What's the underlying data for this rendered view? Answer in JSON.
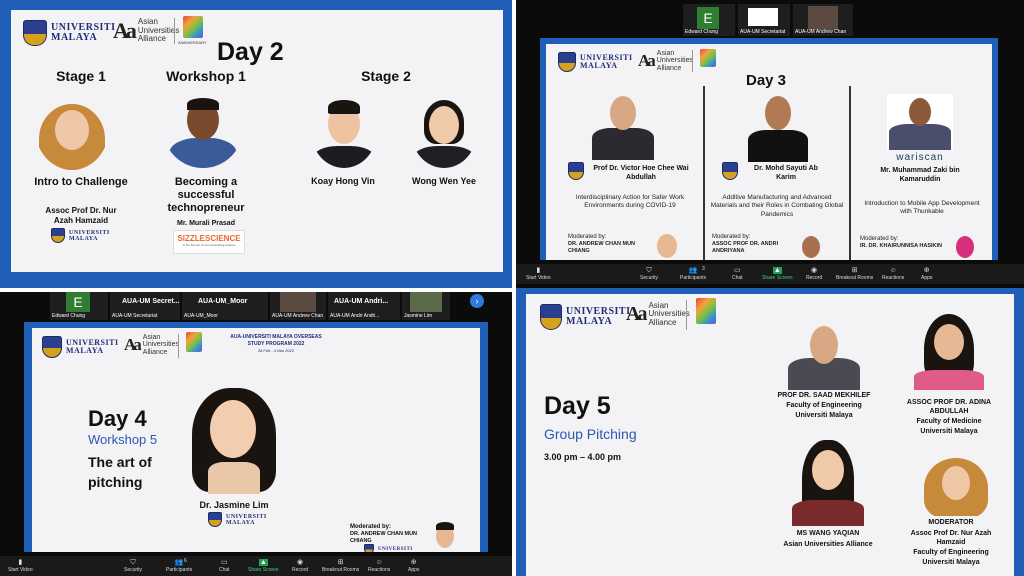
{
  "q1": {
    "um_text": "UNIVERSITI MALAYA",
    "aua_text": "Asian Universities Alliance",
    "anniv": "ANNIVERSARY",
    "day": "Day 2",
    "stage1": {
      "heading": "Stage 1",
      "title": "Intro to Challenge",
      "speaker": "Assoc Prof Dr. Nur Azah Hamzaid",
      "logo": "UNIVERSITI MALAYA"
    },
    "workshop1": {
      "heading": "Workshop 1",
      "title": "Becoming a successful technopreneur",
      "speaker": "Mr. Murali Prasad",
      "logo": "SIZZLESCIENCE",
      "logo_sub": "in the fine art of communicating science"
    },
    "stage2": {
      "heading": "Stage 2",
      "speaker_a": "Koay Hong Vin",
      "speaker_b": "Wong Wen Yee"
    }
  },
  "q2": {
    "tiles": [
      {
        "initial": "E",
        "name": "Edward Chung"
      },
      {
        "name": "AUA-UM Secretariat"
      },
      {
        "name": "AUA-UM Andrew Chan"
      }
    ],
    "um_text": "UNIVERSITI MALAYA",
    "aua_text": "Asian Universities Alliance",
    "day": "Day 3",
    "col1": {
      "speaker": "Prof Dr. Victor Hoe Chee Wai Abdullah",
      "topic": "Interdisciplinary Action for Safer Work Environments during COVID-19",
      "moderated_label": "Moderated by:",
      "moderator": "DR. ANDREW CHAN MUN CHIANG"
    },
    "col2": {
      "speaker": "Dr. Mohd Sayuti Ab Karim",
      "topic": "Additive Manufacturing and Advanced Materials and their Roles in Combating Global Pandemics",
      "moderated_label": "Moderated by:",
      "moderator": "ASSOC PROF DR. ANDRI ANDRIYANA"
    },
    "col3": {
      "logo": "wariscan",
      "speaker": "Mr. Muhammad Zaki bin Kamaruddin",
      "topic": "Introduction to Mobile App Development with Thunkable",
      "moderated_label": "Moderated by:",
      "moderator": "IR. DR. KHAIRUNNISA HASIKIN"
    },
    "toolbar": [
      "Start Video",
      "Security",
      "Participants",
      "Chat",
      "Share Screen",
      "Record",
      "Breakout Rooms",
      "Reactions",
      "Apps"
    ],
    "participants_count": "3"
  },
  "q3": {
    "tiles": [
      {
        "initial": "E",
        "name": "Edward Chung"
      },
      {
        "name": "AUA-UM Secretariat",
        "big": "AUA-UM Secret..."
      },
      {
        "name": "AUA-UM_Moor",
        "big": "AUA-UM_Moor"
      },
      {
        "name": "AUA-UM Andrew Chan"
      },
      {
        "name": "AUA-UM Andri Andri...",
        "big": "AUA-UM Andri..."
      },
      {
        "name": "Jasmine Lim"
      }
    ],
    "um_text": "UNIVERSITI MALAYA",
    "aua_text": "Asian Universities Alliance",
    "program_title": "AUA-UNIVERSITI MALAYA OVERSEAS STUDY PROGRAM 2022",
    "program_dates": "28 Feb - 4 Mar 2022",
    "day": "Day 4",
    "workshop": "Workshop 5",
    "title": "The art of pitching",
    "speaker": "Dr. Jasmine Lim",
    "speaker_logo": "UNIVERSITI MALAYA",
    "moderated_label": "Moderated by:",
    "moderator": "DR. ANDREW CHAN MUN CHIANG",
    "moderator_logo": "UNIVERSITI",
    "toolbar": [
      "Start Video",
      "Security",
      "Participants",
      "Chat",
      "Share Screen",
      "Record",
      "Breakout Rooms",
      "Reactions",
      "Apps"
    ],
    "participants_count": "6"
  },
  "q4": {
    "um_text": "UNIVERSITI MALAYA",
    "aua_text": "Asian Universities Alliance",
    "day": "Day 5",
    "subtitle": "Group Pitching",
    "time": "3.00 pm – 4.00 pm",
    "p1": {
      "name": "PROF DR. SAAD MEKHILEF",
      "l2": "Faculty of Engineering",
      "l3": "Universiti Malaya"
    },
    "p2": {
      "name": "ASSOC PROF DR. ADINA ABDULLAH",
      "l2": "Faculty of Medicine",
      "l3": "Universiti Malaya"
    },
    "p3": {
      "name": "MS WANG YAQIAN",
      "l2": "Asian Universities Alliance"
    },
    "p4": {
      "role": "MODERATOR",
      "name": "Assoc Prof Dr. Nur Azah Hamzaid",
      "l2": "Faculty of Engineering",
      "l3": "Universiti Malaya"
    }
  }
}
